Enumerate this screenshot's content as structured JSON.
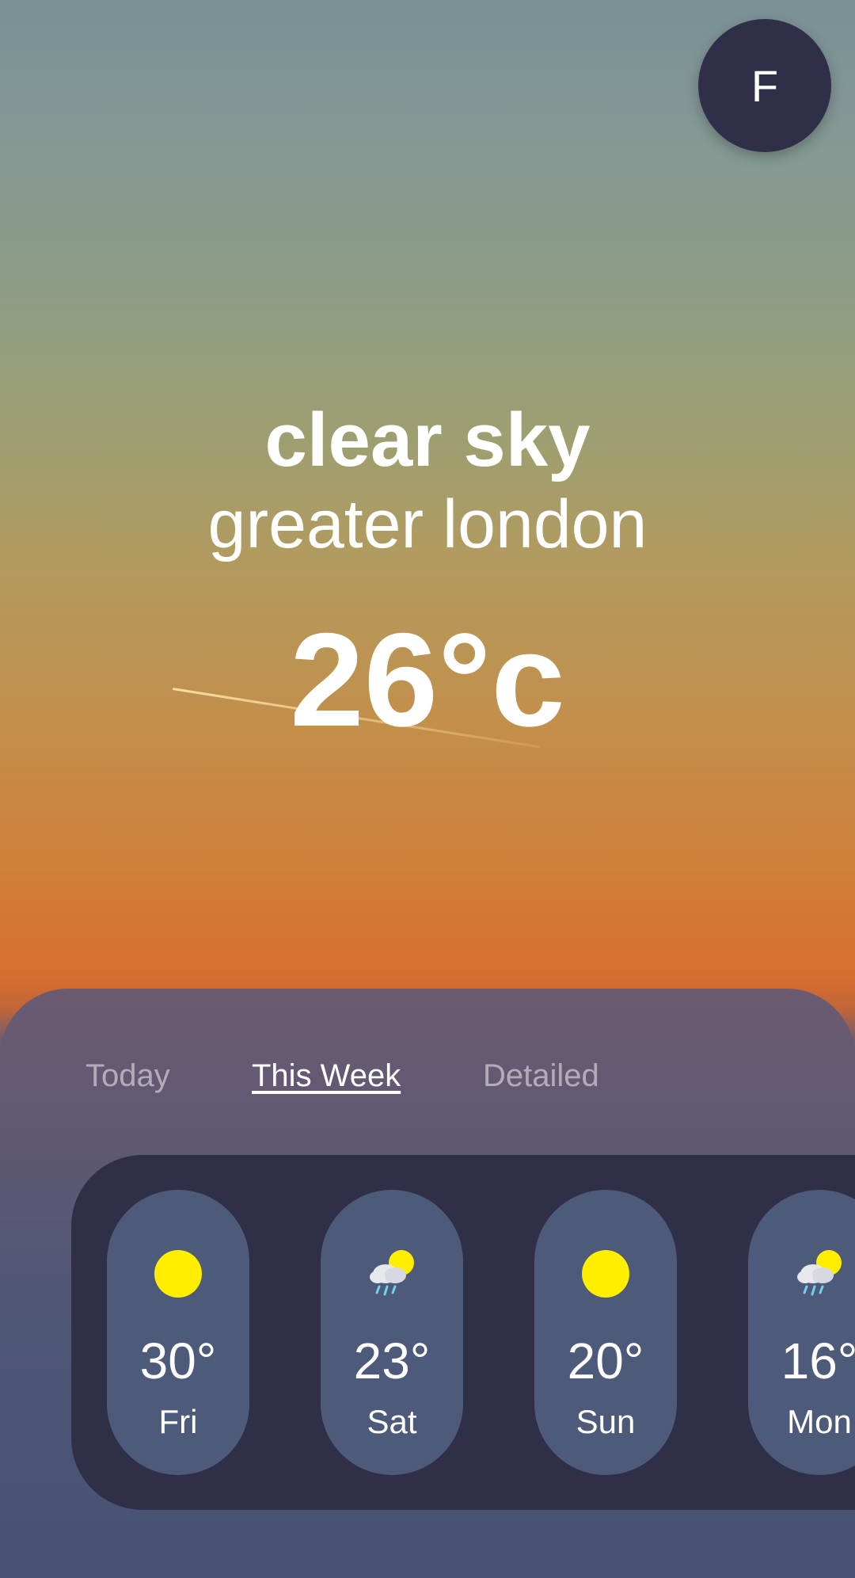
{
  "profile": {
    "initial": "F"
  },
  "weather": {
    "condition": "clear sky",
    "location": "greater london",
    "temperature": "26°c"
  },
  "tabs": [
    {
      "label": "Today",
      "active": false
    },
    {
      "label": "This Week",
      "active": true
    },
    {
      "label": "Detailed",
      "active": false
    }
  ],
  "forecast": [
    {
      "temp": "30°",
      "day": "Fri",
      "icon": "sun-icon"
    },
    {
      "temp": "23°",
      "day": "Sat",
      "icon": "rain-sun-cloud-icon"
    },
    {
      "temp": "20°",
      "day": "Sun",
      "icon": "sun-icon"
    },
    {
      "temp": "16°",
      "day": "Mon",
      "icon": "rain-sun-cloud-icon"
    }
  ],
  "colors": {
    "avatar_bg": "#2f2f4a",
    "forecast_panel_bg": "#2f2f48",
    "day_card_bg": "#4e5a7a",
    "sun_yellow": "#ffee00"
  }
}
